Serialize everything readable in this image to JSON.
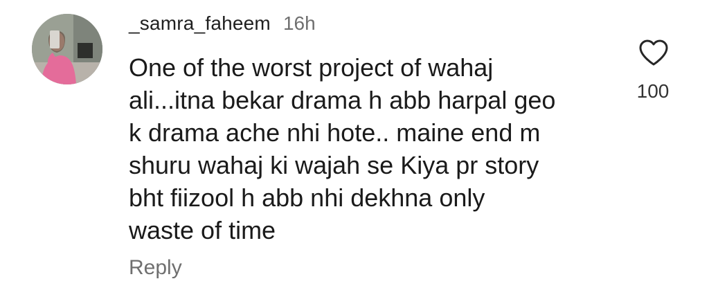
{
  "comment": {
    "username": "_samra_faheem",
    "timestamp": "16h",
    "text_lines": [
      "One of the worst project of wahaj",
      "ali...itna bekar drama h abb harpal geo",
      "k drama ache nhi hote.. maine end m",
      "shuru wahaj ki wajah se Kiya pr story",
      "bht fiizool h abb nhi dekhna only",
      "waste of time"
    ],
    "like_count": "100",
    "reply_label": "Reply",
    "like_icon": "heart-outline-icon"
  },
  "colors": {
    "text": "#1a1a1a",
    "muted": "#6f6f6f",
    "avatar_pink": "#e46c9a"
  }
}
